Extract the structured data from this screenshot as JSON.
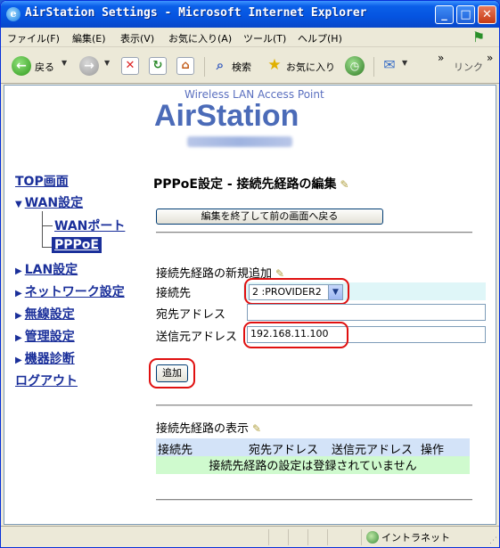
{
  "window": {
    "title": "AirStation Settings - Microsoft Internet Explorer",
    "minimize": "_",
    "maximize": "□",
    "close": "✕"
  },
  "menu": [
    "ファイル(F)",
    "編集(E)",
    "表示(V)",
    "お気に入り(A)",
    "ツール(T)",
    "ヘルプ(H)"
  ],
  "toolbar": {
    "back_label": "戻る",
    "search_label": "検索",
    "favorites_label": "お気に入り",
    "links_label": "リンク",
    "chevron": "»"
  },
  "logo": {
    "tagline": "Wireless LAN Access Point",
    "brand": "AirStation"
  },
  "nav": {
    "top": "TOP画面",
    "wan": "WAN設定",
    "wan_port": "WANポート",
    "pppoe": "PPPoE",
    "lan": "LAN設定",
    "network": "ネットワーク設定",
    "wireless": "無線設定",
    "admin": "管理設定",
    "diag": "機器診断",
    "logout": "ログアウト"
  },
  "page": {
    "title": "PPPoE設定 - 接続先経路の編集",
    "back_button": "編集を終了して前の画面へ戻る",
    "new_section_title": "接続先経路の新規追加",
    "label_destination": "接続先",
    "label_dest_address": "宛先アドレス",
    "label_src_address": "送信元アドレス",
    "destination_value": "2 :PROVIDER2",
    "dest_address_value": "",
    "src_address_value": "192.168.11.100",
    "add_button": "追加",
    "list_section_title": "接続先経路の表示",
    "list_headers": [
      "接続先",
      "宛先アドレス",
      "送信元アドレス",
      "操作"
    ],
    "list_empty": "接続先経路の設定は登録されていません"
  },
  "status": {
    "zone": "イントラネット"
  }
}
